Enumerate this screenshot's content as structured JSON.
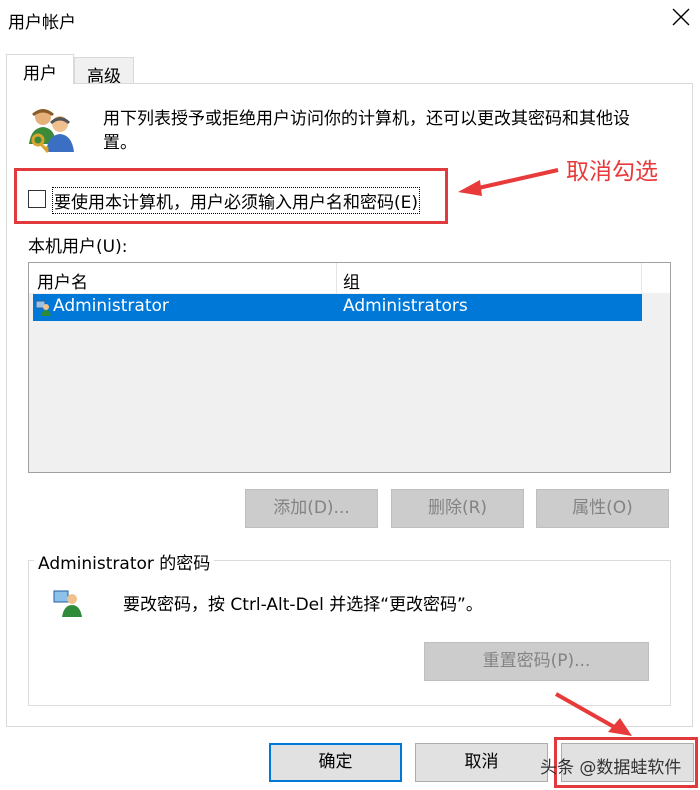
{
  "window": {
    "title": "用户帐户"
  },
  "tabs": [
    {
      "label": "用户"
    },
    {
      "label": "高级"
    }
  ],
  "description": "用下列表授予或拒绝用户访问你的计算机，还可以更改其密码和其他设置。",
  "require_login_checkbox": {
    "label": "要使用本计算机，用户必须输入用户名和密码(E)",
    "checked": false
  },
  "annotation": {
    "text": "取消勾选",
    "color": "#e83a3a"
  },
  "local_users": {
    "label": "本机用户(U):",
    "columns": [
      "用户名",
      "组"
    ],
    "rows": [
      {
        "user": "Administrator",
        "group": "Administrators",
        "selected": true
      }
    ]
  },
  "user_buttons": {
    "add": "添加(D)...",
    "remove": "删除(R)",
    "properties": "属性(O)"
  },
  "password_group": {
    "title": "Administrator 的密码",
    "text": "要改密码，按 Ctrl-Alt-Del 并选择“更改密码”。",
    "reset_button": "重置密码(P)..."
  },
  "dialog_buttons": {
    "ok": "确定",
    "cancel": "取消"
  },
  "watermark": "头条 @数据蛙软件",
  "colors": {
    "selection": "#0078d7",
    "annotation_red": "#e0393e"
  }
}
